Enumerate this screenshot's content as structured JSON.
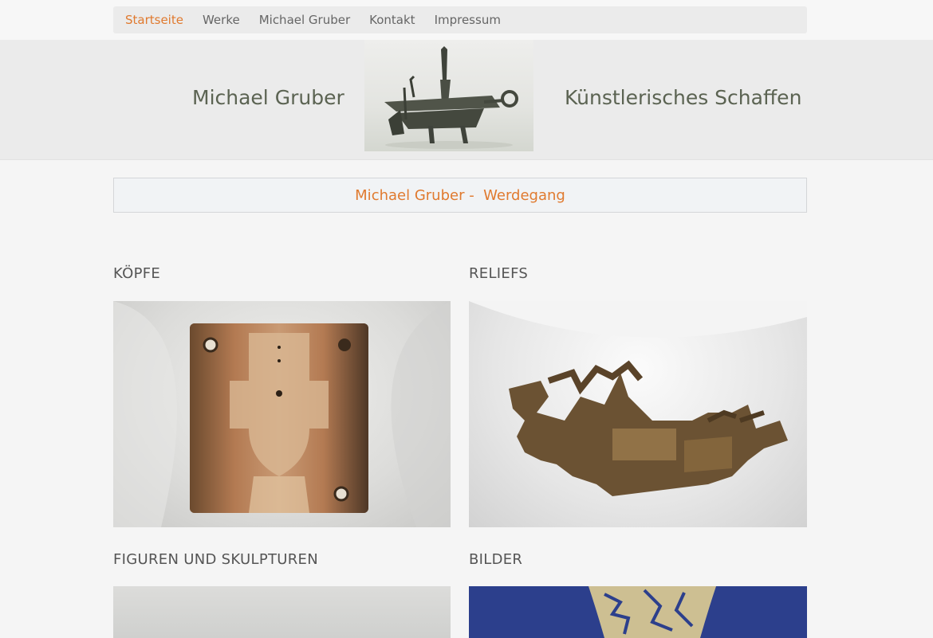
{
  "nav": {
    "items": [
      {
        "label": "Startseite",
        "active": true
      },
      {
        "label": "Werke",
        "active": false
      },
      {
        "label": "Michael Gruber",
        "active": false
      },
      {
        "label": "Kontakt",
        "active": false
      },
      {
        "label": "Impressum",
        "active": false
      }
    ]
  },
  "banner": {
    "left_title": "Michael Gruber",
    "right_title": "Künstlerisches Schaffen"
  },
  "werdegang": {
    "label": "Michael Gruber -  Werdegang"
  },
  "sections": [
    {
      "title": "KÖPFE"
    },
    {
      "title": "RELIEFS"
    },
    {
      "title": "FIGUREN UND SKULPTUREN"
    },
    {
      "title": "BILDER"
    }
  ],
  "colors": {
    "accent": "#e07a2f",
    "text": "#555555",
    "nav_bg": "#ebebeb"
  }
}
